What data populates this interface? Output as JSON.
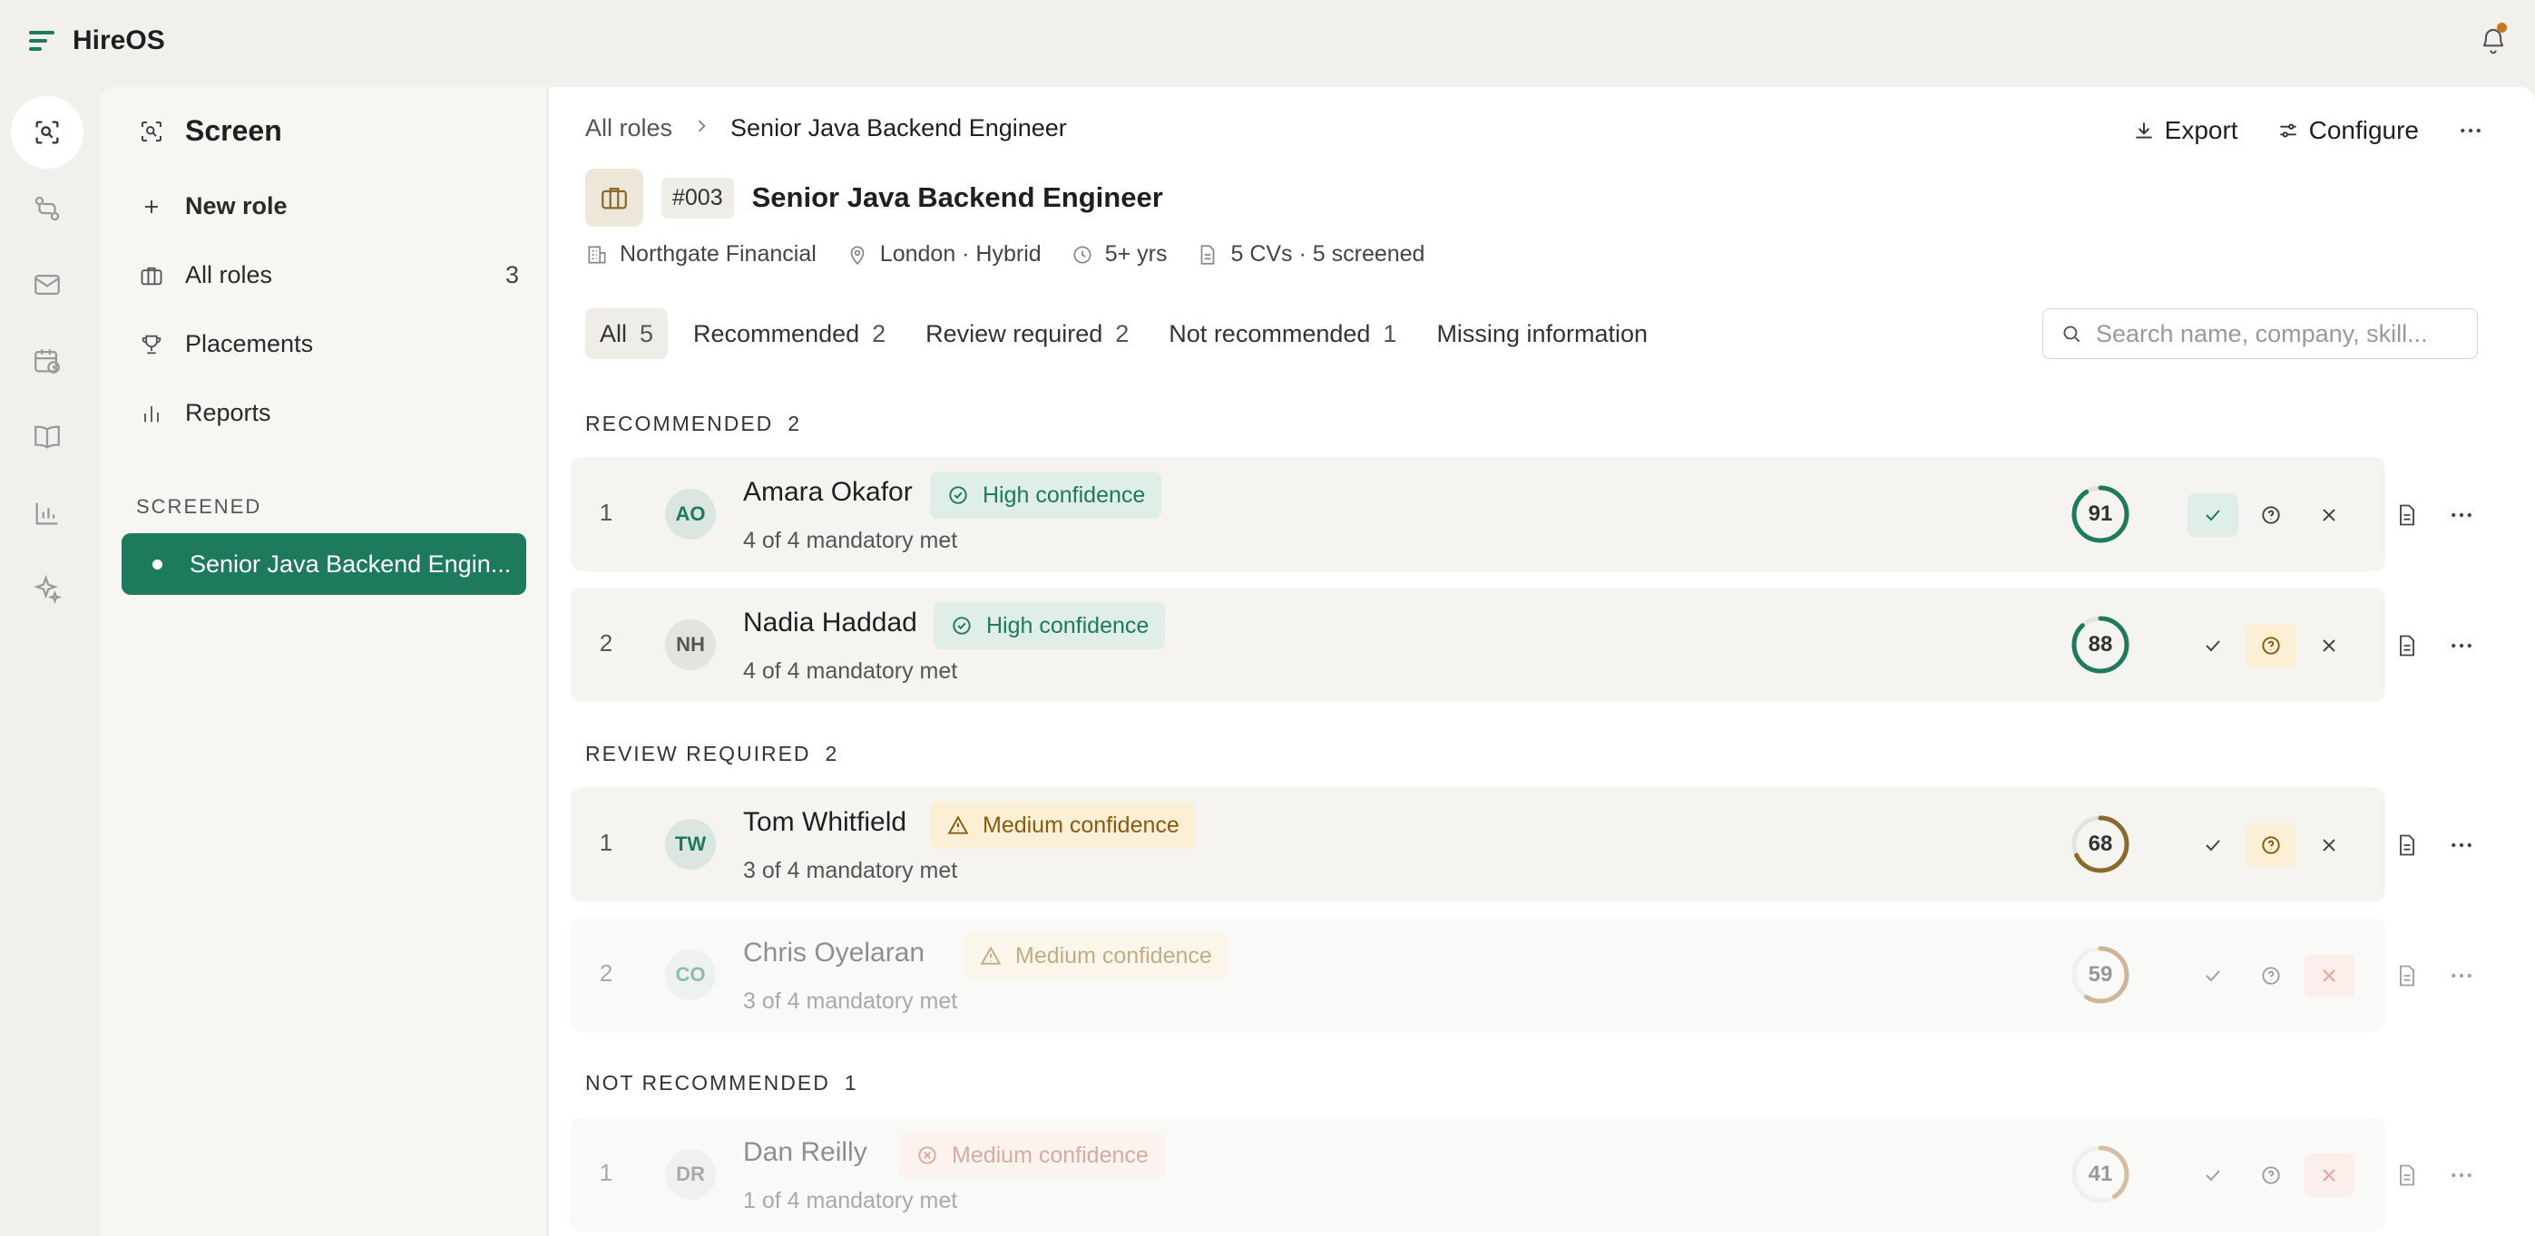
{
  "app": {
    "title": "HireOS"
  },
  "colors": {
    "accent": "#1e7a5c",
    "warning": "#8a5a10",
    "danger": "#b05a40"
  },
  "rail": [
    "screen-icon",
    "pipeline-icon",
    "mail-icon",
    "calendar-icon",
    "book-icon",
    "chart-icon",
    "sparkle-icon"
  ],
  "sidebar": {
    "title": "Screen",
    "new_role": "New role",
    "all_roles": "All roles",
    "all_roles_count": "3",
    "placements": "Placements",
    "reports": "Reports",
    "section": "SCREENED",
    "active_item": "Senior Java Backend Engin..."
  },
  "header": {
    "crumb_root": "All roles",
    "crumb_current": "Senior Java Backend Engineer",
    "export": "Export",
    "configure": "Configure",
    "role_id": "#003",
    "role_title": "Senior Java Backend Engineer",
    "company": "Northgate Financial",
    "location": "London · Hybrid",
    "experience": "5+ yrs",
    "cvs": "5 CVs · 5 screened"
  },
  "filters": {
    "all": "All",
    "all_n": "5",
    "recommended": "Recommended",
    "recommended_n": "2",
    "review": "Review required",
    "review_n": "2",
    "not_recommended": "Not recommended",
    "not_recommended_n": "1",
    "missing": "Missing information"
  },
  "search": {
    "placeholder": "Search name, company, skill..."
  },
  "groups": {
    "recommended": {
      "label": "RECOMMENDED",
      "count": "2"
    },
    "review": {
      "label": "REVIEW REQUIRED",
      "count": "2"
    },
    "not_recommended": {
      "label": "NOT RECOMMENDED",
      "count": "1"
    }
  },
  "candidates": [
    {
      "rank": "1",
      "initials": "AO",
      "name": "Amara Okafor",
      "confidence": "High confidence",
      "mandatory": "4 of 4 mandatory met",
      "score": "91",
      "score_pct": 0.91,
      "ring": "#1e7a5c"
    },
    {
      "rank": "2",
      "initials": "NH",
      "name": "Nadia Haddad",
      "confidence": "High confidence",
      "mandatory": "4 of 4 mandatory met",
      "score": "88",
      "score_pct": 0.88,
      "ring": "#1e7a5c"
    },
    {
      "rank": "1",
      "initials": "TW",
      "name": "Tom Whitfield",
      "confidence": "Medium confidence",
      "mandatory": "3 of 4 mandatory met",
      "score": "68",
      "score_pct": 0.68,
      "ring": "#8a6a2a"
    },
    {
      "rank": "2",
      "initials": "CO",
      "name": "Chris Oyelaran",
      "confidence": "Medium confidence",
      "mandatory": "3 of 4 mandatory met",
      "score": "59",
      "score_pct": 0.59,
      "ring": "#a0703a"
    },
    {
      "rank": "1",
      "initials": "DR",
      "name": "Dan Reilly",
      "confidence": "Medium confidence",
      "mandatory": "1 of 4 mandatory met",
      "score": "41",
      "score_pct": 0.41,
      "ring": "#b07a4a"
    }
  ]
}
